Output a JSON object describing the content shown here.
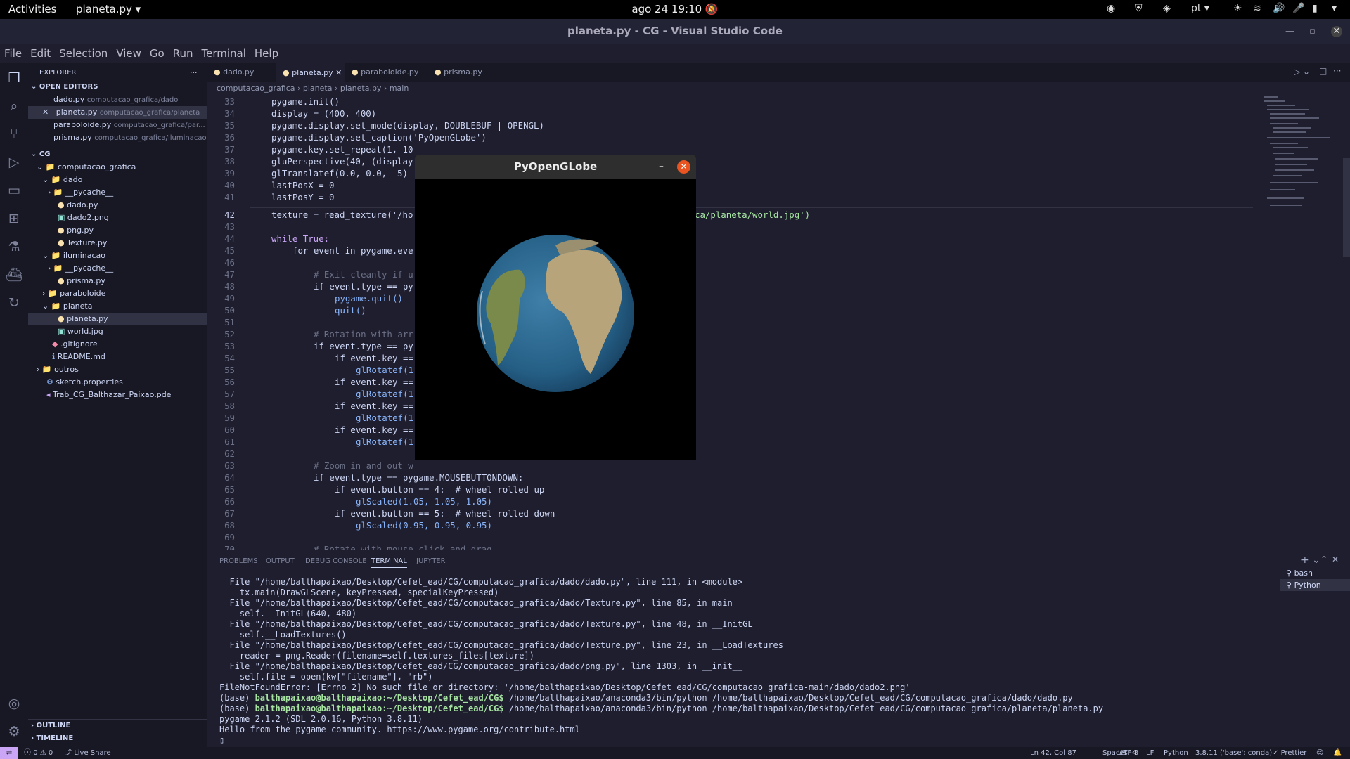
{
  "top": {
    "activities": "Activities",
    "app": "planeta.py",
    "clock": "ago 24  19:10",
    "lang": "pt"
  },
  "window": {
    "title": "planeta.py - CG - Visual Studio Code"
  },
  "menu": [
    "File",
    "Edit",
    "Selection",
    "View",
    "Go",
    "Run",
    "Terminal",
    "Help"
  ],
  "sidebar": {
    "title": "EXPLORER",
    "open_editors": "OPEN EDITORS",
    "editors": [
      {
        "name": "dado.py",
        "path": "computacao_grafica/dado"
      },
      {
        "name": "planeta.py",
        "path": "computacao_grafica/planeta"
      },
      {
        "name": "paraboloide.py",
        "path": "computacao_grafica/par..."
      },
      {
        "name": "prisma.py",
        "path": "computacao_grafica/iluminacao"
      }
    ],
    "root": "CG",
    "tree": [
      "computacao_grafica",
      "dado",
      "__pycache__",
      "dado.py",
      "dado2.png",
      "png.py",
      "Texture.py",
      "iluminacao",
      "__pycache__",
      "prisma.py",
      "paraboloide",
      "planeta",
      "planeta.py",
      "world.jpg",
      ".gitignore",
      "README.md",
      "outros",
      "sketch.properties",
      "Trab_CG_Balthazar_Paixao.pde"
    ],
    "outline": "OUTLINE",
    "timeline": "TIMELINE"
  },
  "tabs": [
    "dado.py",
    "planeta.py",
    "paraboloide.py",
    "prisma.py"
  ],
  "breadcrumb": [
    "computacao_grafica",
    "planeta",
    "planeta.py",
    "main"
  ],
  "code": {
    "lines": [
      "33",
      "34",
      "35",
      "36",
      "37",
      "38",
      "39",
      "40",
      "41",
      "42",
      "43",
      "44",
      "45",
      "46",
      "47",
      "48",
      "49",
      "50",
      "51",
      "52",
      "53",
      "54",
      "55",
      "56",
      "57",
      "58",
      "59",
      "60",
      "61",
      "62",
      "63",
      "64",
      "65",
      "66",
      "67",
      "68",
      "69",
      "70"
    ],
    "l33": "pygame.init()",
    "l34": "display = (400, 400)",
    "l35": "pygame.display.set_mode(display, DOUBLEBUF | OPENGL)",
    "l36": "pygame.display.set_caption('PyOpenGLobe')",
    "l37": "pygame.key.set_repeat(1, 10",
    "l38": "gluPerspective(40, (display",
    "l39": "glTranslatef(0.0, 0.0, -5)",
    "l40": "lastPosX = 0",
    "l41": "lastPosY = 0",
    "l42a": "texture = read_texture('/ho",
    "l42b": "ca/planeta/world.jpg')",
    "l44": "while True:",
    "l45": "for event in pygame.eve",
    "l47": "# Exit cleanly if u",
    "l48": "if event.type == py",
    "l49": "pygame.quit()",
    "l50": "quit()",
    "l52": "# Rotation with arr",
    "l53": "if event.type == py",
    "l54": "if event.key ==",
    "l55": "glRotatef(1",
    "l56": "if event.key ==",
    "l57": "glRotatef(1",
    "l58": "if event.key ==",
    "l59": "glRotatef(1",
    "l60": "if event.key ==",
    "l61": "glRotatef(1",
    "l63": "# Zoom in and out w",
    "l64": "if event.type == pygame.MOUSEBUTTONDOWN:",
    "l65": "if event.button == 4:  # wheel rolled up",
    "l66": "glScaled(1.05, 1.05, 1.05)",
    "l67": "if event.button == 5:  # wheel rolled down",
    "l68": "glScaled(0.95, 0.95, 0.95)",
    "l70": "# Rotate with mouse click and drag"
  },
  "panel": {
    "tabs": [
      "PROBLEMS",
      "OUTPUT",
      "DEBUG CONSOLE",
      "TERMINAL",
      "JUPYTER"
    ],
    "shells": [
      "bash",
      "Python"
    ],
    "terminal": [
      "  File \"/home/balthapaixao/Desktop/Cefet_ead/CG/computacao_grafica/dado/dado.py\", line 111, in <module>",
      "    tx.main(DrawGLScene, keyPressed, specialKeyPressed)",
      "  File \"/home/balthapaixao/Desktop/Cefet_ead/CG/computacao_grafica/dado/Texture.py\", line 85, in main",
      "    self.__InitGL(640, 480)",
      "  File \"/home/balthapaixao/Desktop/Cefet_ead/CG/computacao_grafica/dado/Texture.py\", line 48, in __InitGL",
      "    self.__LoadTextures()",
      "  File \"/home/balthapaixao/Desktop/Cefet_ead/CG/computacao_grafica/dado/Texture.py\", line 23, in __LoadTextures",
      "    reader = png.Reader(filename=self.textures_files[texture])",
      "  File \"/home/balthapaixao/Desktop/Cefet_ead/CG/computacao_grafica/dado/png.py\", line 1303, in __init__",
      "    self.file = open(kw[\"filename\"], \"rb\")",
      "FileNotFoundError: [Errno 2] No such file or directory: '/home/balthapaixao/Desktop/Cefet_ead/CG/computacao_grafica-main/dado/dado2.png'"
    ],
    "prompt_base": "(base) ",
    "prompt": "balthapaixao@balthapaixao:~/Desktop/Cefet_ead/CG$",
    "cmd1": " /home/balthapaixao/anaconda3/bin/python /home/balthapaixao/Desktop/Cefet_ead/CG/computacao_grafica/dado/dado.py",
    "cmd2": " /home/balthapaixao/anaconda3/bin/python /home/balthapaixao/Desktop/Cefet_ead/CG/computacao_grafica/planeta/planeta.py",
    "out1": "pygame 2.1.2 (SDL 2.0.16, Python 3.8.11)",
    "out2": "Hello from the pygame community. https://www.pygame.org/contribute.html"
  },
  "status": {
    "errors": "0",
    "warnings": "0",
    "liveshare": "Live Share",
    "pos": "Ln 42, Col 87",
    "spaces": "Spaces: 4",
    "enc": "UTF-8",
    "eol": "LF",
    "lang": "Python",
    "interp": "3.8.11 ('base': conda)",
    "prettier": "Prettier"
  },
  "pygame_window": {
    "title": "PyOpenGLobe"
  }
}
